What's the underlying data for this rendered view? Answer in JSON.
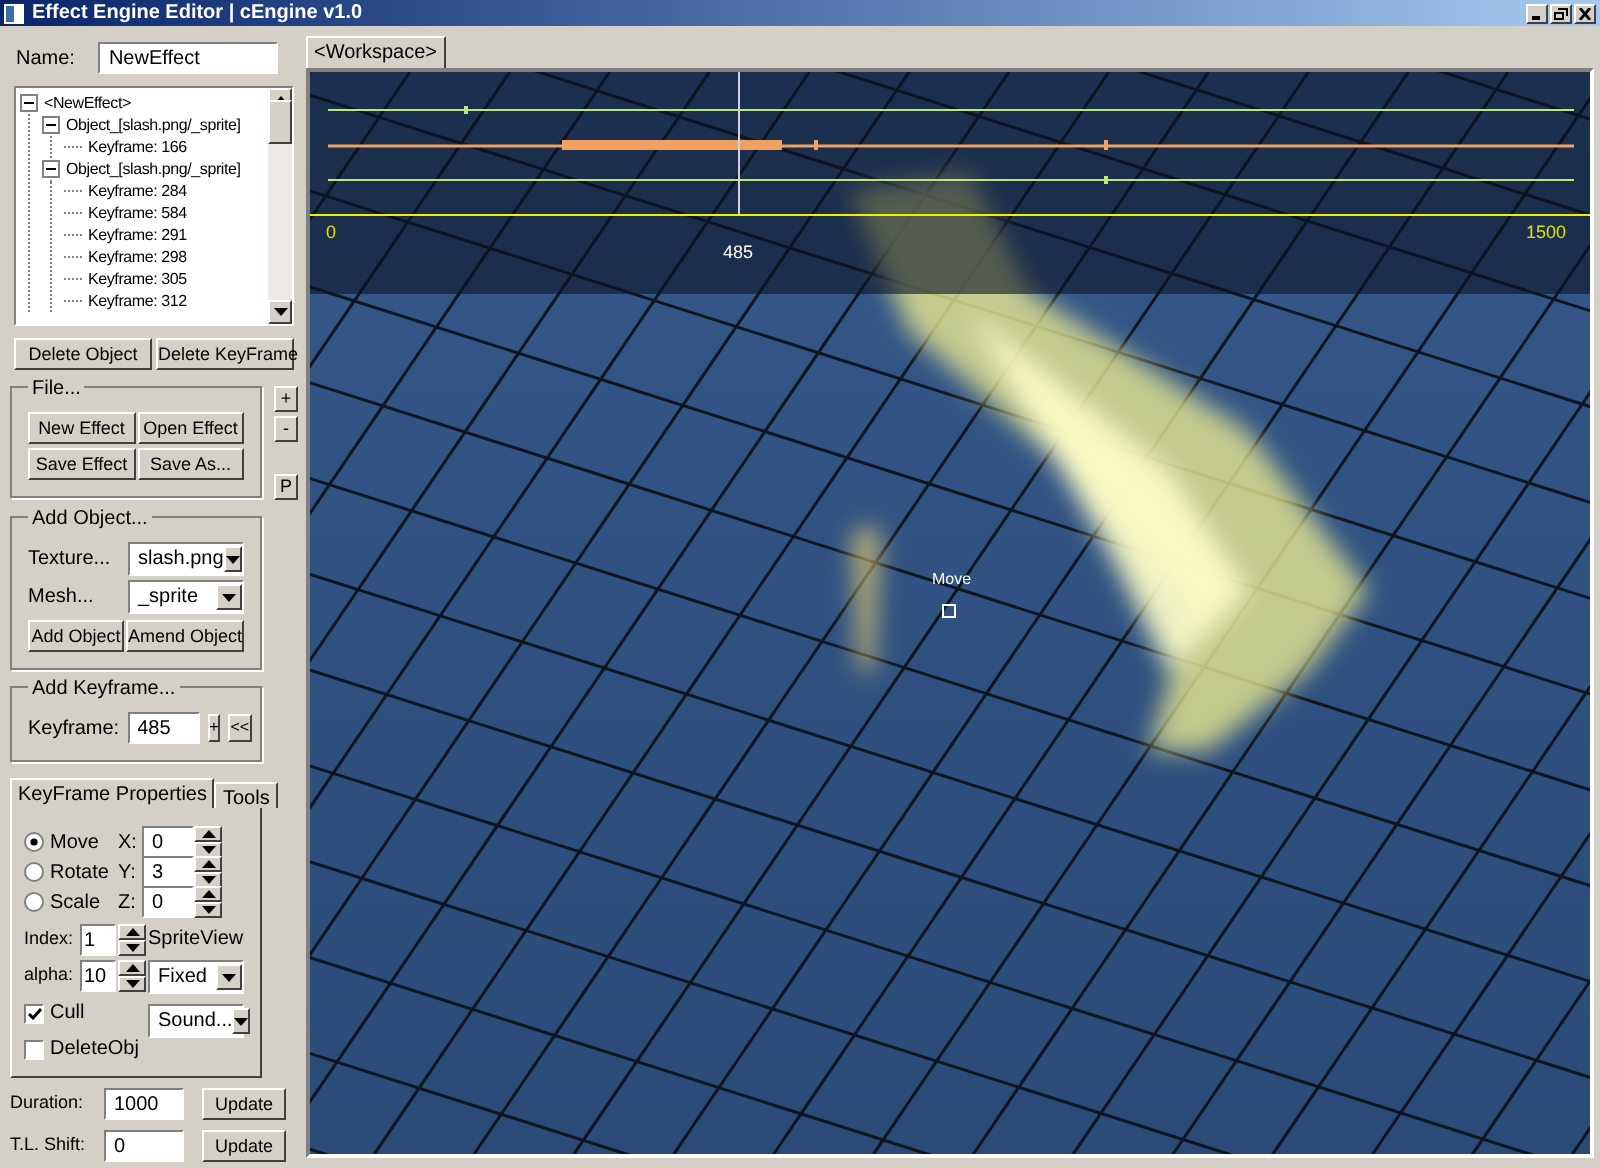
{
  "window": {
    "title": "Effect Engine Editor | cEngine v1.0"
  },
  "name_field": {
    "label": "Name:",
    "value": "NewEffect"
  },
  "tree": [
    {
      "label": "<NewEffect>",
      "expanded": true,
      "children": [
        {
          "label": "Object_[slash.png/_sprite]",
          "expanded": true,
          "children": [
            {
              "label": "Keyframe: 166"
            }
          ]
        },
        {
          "label": "Object_[slash.png/_sprite]",
          "expanded": true,
          "children": [
            {
              "label": "Keyframe: 284"
            },
            {
              "label": "Keyframe: 584"
            },
            {
              "label": "Keyframe: 291"
            },
            {
              "label": "Keyframe: 298"
            },
            {
              "label": "Keyframe: 305"
            },
            {
              "label": "Keyframe: 312"
            }
          ]
        }
      ]
    }
  ],
  "tree_buttons": [
    "Delete Object",
    "Delete KeyFrame"
  ],
  "file_group": {
    "title": "File...",
    "buttons": [
      "New Effect",
      "Open Effect",
      "Save Effect",
      "Save As..."
    ]
  },
  "side_buttons": [
    "+",
    "-",
    "P"
  ],
  "add_object": {
    "title": "Add Object...",
    "texture": {
      "label": "Texture...",
      "value": "slash.png"
    },
    "mesh": {
      "label": "Mesh...",
      "value": "_sprite"
    },
    "buttons": [
      "Add Object",
      "Amend Object"
    ]
  },
  "add_keyframe": {
    "title": "Add Keyframe...",
    "label": "Keyframe:",
    "value": "485",
    "buttons": [
      "+",
      "<<"
    ]
  },
  "tabs": [
    {
      "label": "KeyFrame Properties",
      "selected": true
    },
    {
      "label": "Tools",
      "selected": false
    }
  ],
  "transforms": [
    {
      "label": "Move",
      "selected": true,
      "axis": "X:",
      "value": "0"
    },
    {
      "label": "Rotate",
      "selected": false,
      "axis": "Y:",
      "value": "3"
    },
    {
      "label": "Scale",
      "selected": false,
      "axis": "Z:",
      "value": "0"
    }
  ],
  "index": {
    "label": "Index:",
    "value": "1"
  },
  "alpha": {
    "label": "alpha:",
    "value": "10"
  },
  "sprite_view": {
    "label": "SpriteView",
    "value": "Fixed"
  },
  "sound": {
    "value": "Sound..."
  },
  "checkboxes": [
    {
      "label": "Cull",
      "checked": true
    },
    {
      "label": "DeleteObj",
      "checked": false
    }
  ],
  "duration": {
    "label": "Duration:",
    "value": "1000",
    "button": "Update"
  },
  "tl_shift": {
    "label": "T.L. Shift:",
    "value": "0",
    "button": "Update"
  },
  "workspace_tab": {
    "label": "<Workspace>",
    "selected": true
  },
  "timeline": {
    "start": "0",
    "cursor_label": "485",
    "end": "1500",
    "cursor": {
      "level": 0.34
    }
  },
  "gizmo": {
    "label": "Move"
  }
}
